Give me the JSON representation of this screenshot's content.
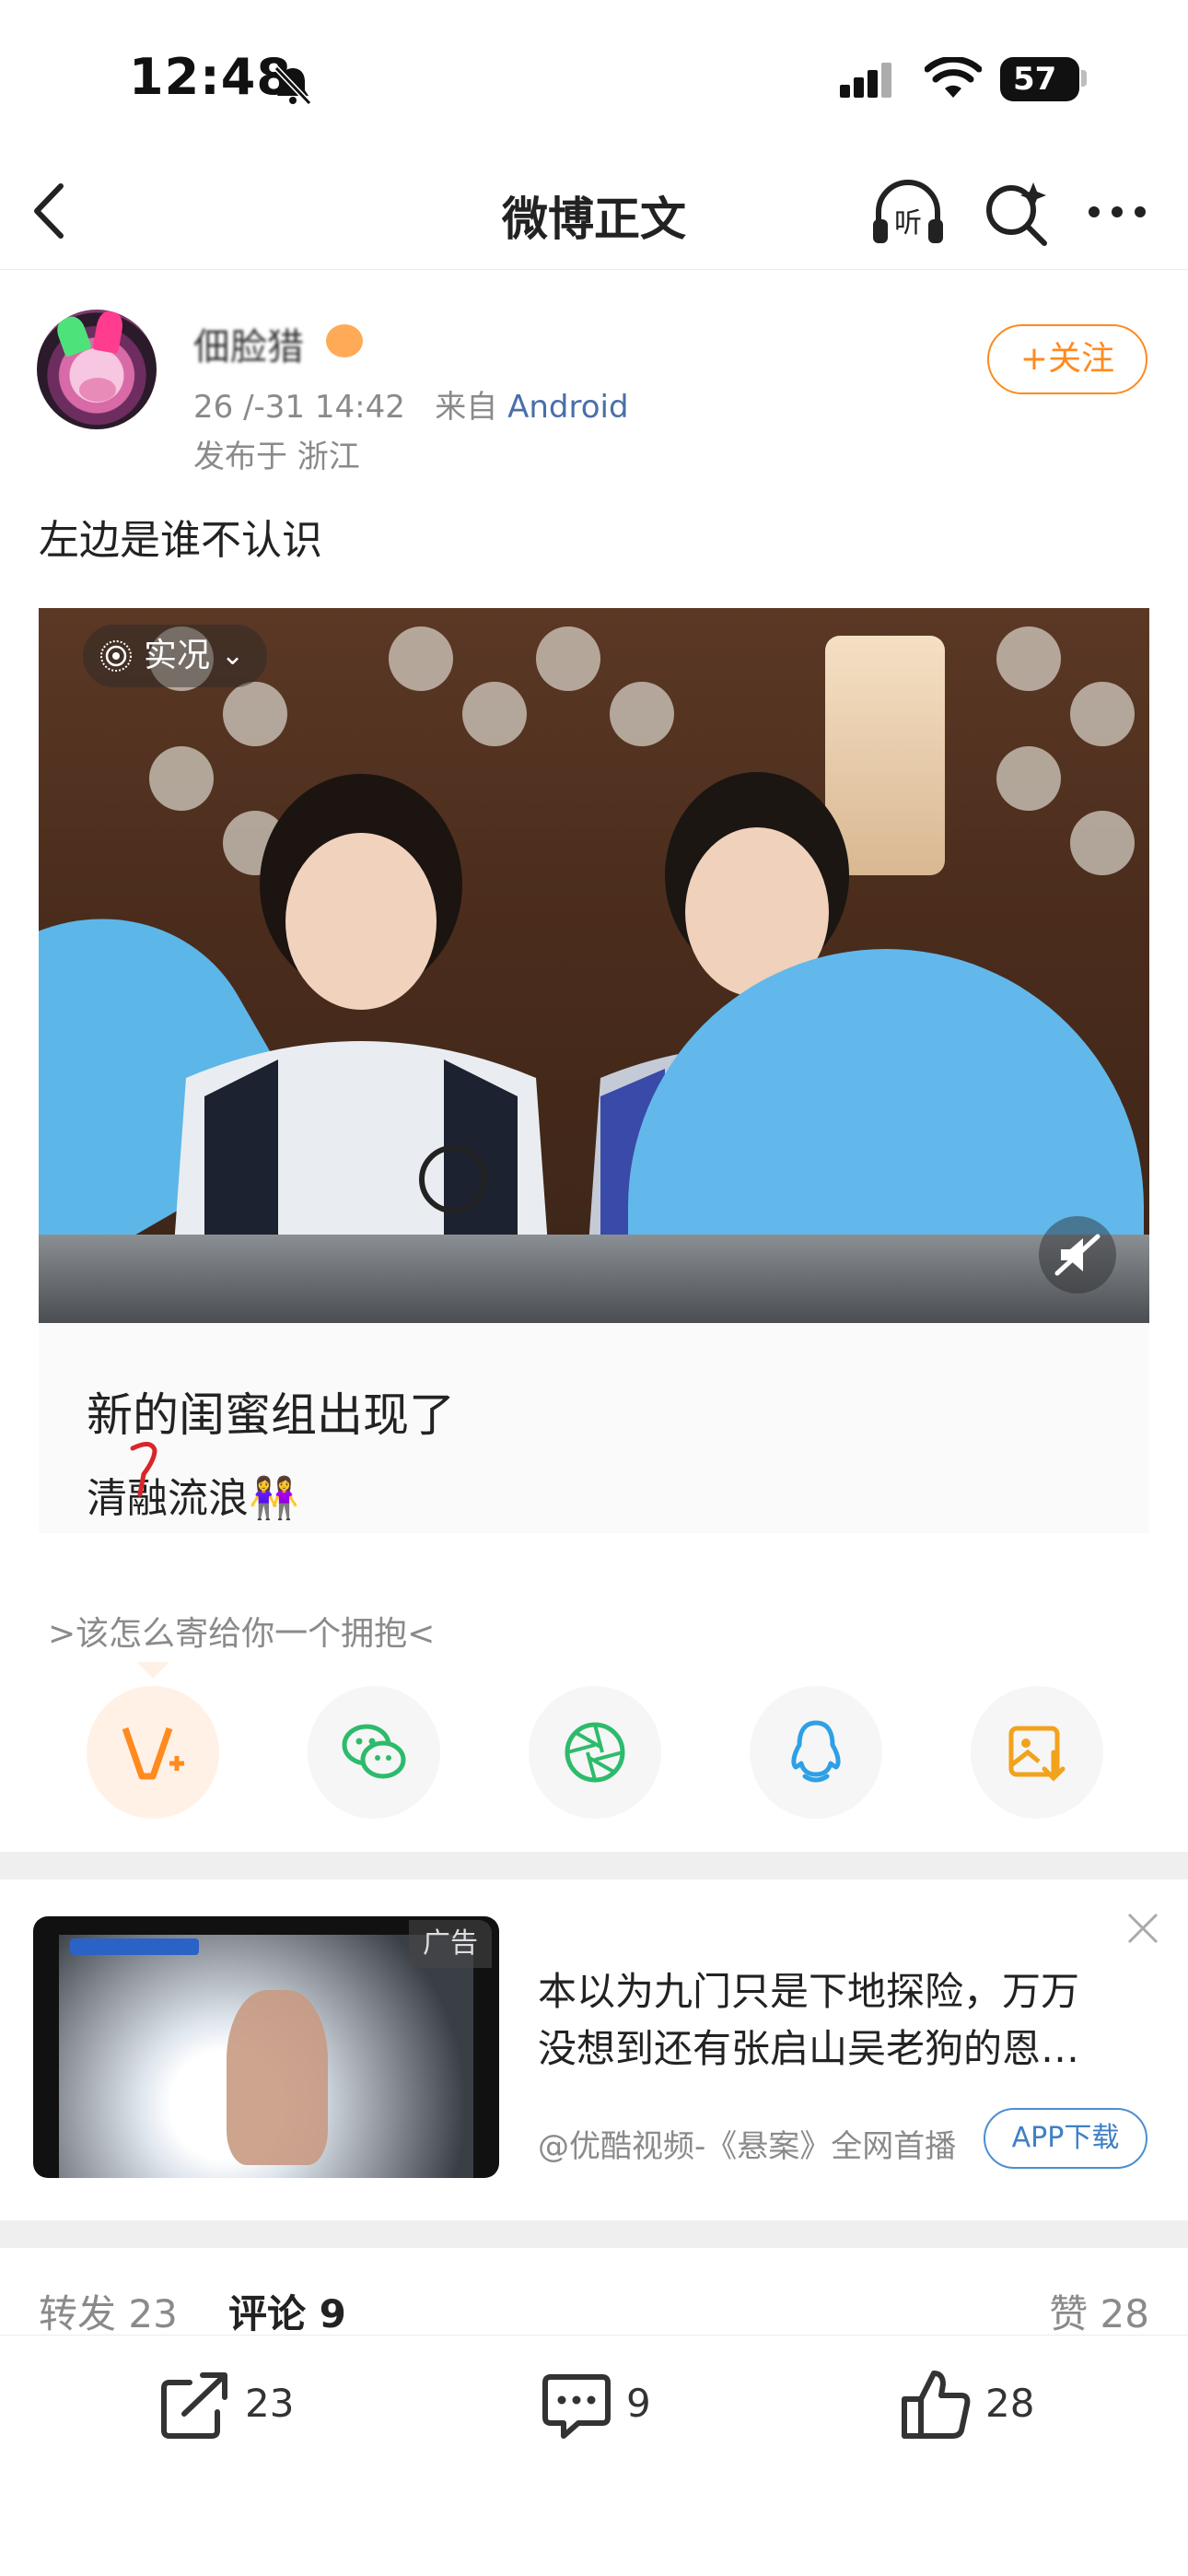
{
  "status_bar": {
    "time": "12:48",
    "battery": "57"
  },
  "nav": {
    "title": "微博正文",
    "listen_label": "听"
  },
  "post": {
    "author": "佃脸猎",
    "time": "26 /-31 14:42",
    "source_prefix": "来自",
    "device": "Android",
    "location": "发布于 浙江",
    "follow_label": "+关注",
    "text": "左边是谁不认识",
    "live_label": "实况",
    "caption_line1": "新的闺蜜组出现了",
    "caption_line2": "清融流浪👭"
  },
  "share": {
    "prompt": ">该怎么寄给你一个拥抱<"
  },
  "ad": {
    "label": "广告",
    "title_line1": "本以为九门只是下地探险，万万",
    "title_line2": "没想到还有张启山吴老狗的恩…",
    "source": "@优酷视频-《悬案》全网首播",
    "download": "APP下载"
  },
  "counts": {
    "repost": "转发 23",
    "comment": "评论 9",
    "like": "赞 28"
  },
  "bottom_bar": {
    "repost": "23",
    "comment": "9",
    "like": "28"
  },
  "colors": {
    "accent": "#ff8a1e",
    "link": "#4a6ea9"
  }
}
